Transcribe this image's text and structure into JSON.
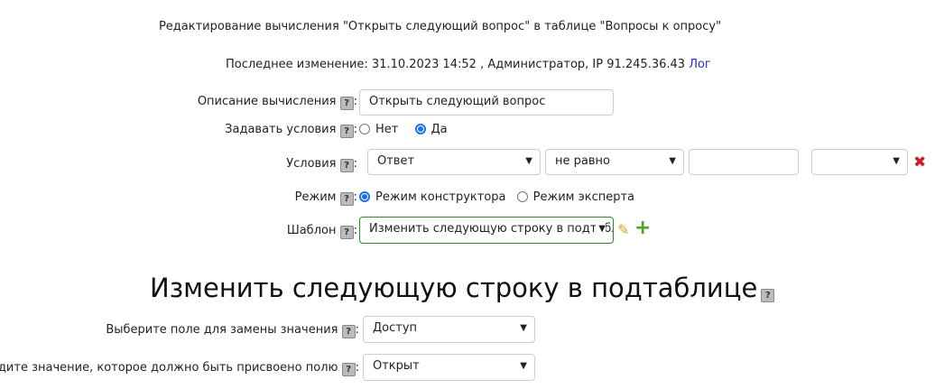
{
  "title": "Редактирование вычисления \"Открыть следующий вопрос\" в таблице \"Вопросы к опросу\"",
  "last_change": "Последнее изменение: 31.10.2023 14:52 , Администратор, IP 91.245.36.43",
  "log_link": "Лог",
  "help": "?",
  "description": {
    "label": "Описание вычисления",
    "value": "Открыть следующий вопрос"
  },
  "set_conditions": {
    "label": "Задавать условия",
    "options": [
      "Нет",
      "Да"
    ],
    "selected": "Да"
  },
  "conditions": {
    "label": "Условия",
    "field": "Ответ",
    "operator": "не равно",
    "value": "",
    "extra": ""
  },
  "mode": {
    "label": "Режим",
    "options": [
      "Режим конструктора",
      "Режим эксперта"
    ],
    "selected": "Режим конструктора"
  },
  "template": {
    "label": "Шаблон",
    "value": "Изменить следующую строку в подтаблице"
  },
  "section": {
    "heading": "Изменить следующую строку в подтаблице",
    "field_label": "Выберите поле для замены значения",
    "field_value": "Доступ",
    "value_label": "Введите значение, которое должно быть присвоено полю",
    "value_value": "Открыт"
  },
  "colors": {
    "link": "#2a2ad0",
    "accent": "#1a73e8",
    "template_border": "#2a8a2a",
    "delete": "#cc2222",
    "add": "#44aa22"
  }
}
